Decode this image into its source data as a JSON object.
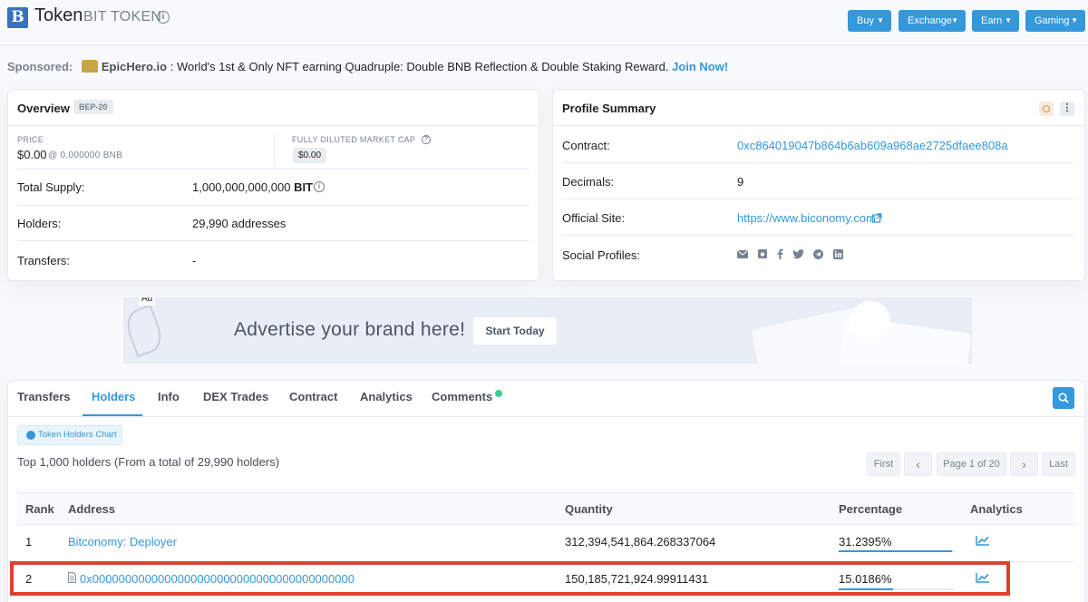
{
  "header": {
    "logo_letter": "B",
    "title": "Token",
    "subtitle": "BIT TOKEN",
    "info_icon": "info-circle-icon",
    "menu": [
      {
        "label": "Buy"
      },
      {
        "label": "Exchange"
      },
      {
        "label": "Earn"
      },
      {
        "label": "Gaming"
      }
    ]
  },
  "sponsored": {
    "label": "Sponsored:",
    "brand": "EpicHero.io",
    "text": ": World's 1st & Only NFT earning Quadruple: Double BNB Reflection & Double Staking Reward.",
    "cta": "Join Now!"
  },
  "overview": {
    "title": "Overview",
    "badge": "BEP-20",
    "price_label": "PRICE",
    "price": "$0.00",
    "price_bnb": "@ 0.000000 BNB",
    "fdmc_label": "FULLY DILUTED MARKET CAP",
    "fdmc_value": "$0.00",
    "total_supply_label": "Total Supply:",
    "total_supply_value": "1,000,000,000,000",
    "total_supply_symbol": "BIT",
    "holders_label": "Holders:",
    "holders_value": "29,990 addresses",
    "transfers_label": "Transfers:",
    "transfers_value": "-"
  },
  "profile": {
    "title": "Profile Summary",
    "contract_label": "Contract:",
    "contract_value": "0xc864019047b864b6ab609a968ae2725dfaee808a",
    "decimals_label": "Decimals:",
    "decimals_value": "9",
    "site_label": "Official Site:",
    "site_value": "https://www.biconomy.com",
    "social_label": "Social Profiles:",
    "social_icons": [
      "email-icon",
      "medium-icon",
      "facebook-icon",
      "twitter-icon",
      "telegram-icon",
      "linkedin-icon"
    ]
  },
  "ad": {
    "tag": "Ad",
    "text": "Advertise your brand here!",
    "button": "Start Today"
  },
  "tabs": [
    {
      "label": "Transfers",
      "active": false
    },
    {
      "label": "Holders",
      "active": true
    },
    {
      "label": "Info",
      "active": false
    },
    {
      "label": "DEX Trades",
      "active": false
    },
    {
      "label": "Contract",
      "active": false
    },
    {
      "label": "Analytics",
      "active": false
    },
    {
      "label": "Comments",
      "active": false
    }
  ],
  "holders": {
    "chart_button": "Token Holders Chart",
    "summary": "Top 1,000 holders (From a total of 29,990 holders)",
    "pagination": {
      "first": "First",
      "prev": "‹",
      "page": "Page 1 of 20",
      "next": "›",
      "last": "Last"
    },
    "columns": [
      "Rank",
      "Address",
      "Quantity",
      "Percentage",
      "Analytics"
    ],
    "rows": [
      {
        "rank": "1",
        "address": "Bitconomy: Deployer",
        "quantity": "312,394,541,864.268337064",
        "percentage": "31.2395%",
        "pct_value": 0.312395
      },
      {
        "rank": "2",
        "address": "0x0000000000000000000000000000000000000000",
        "quantity": "150,185,721,924.99911431",
        "percentage": "15.0186%",
        "pct_value": 0.150186
      }
    ]
  },
  "colors": {
    "accent": "#3498db",
    "highlight": "#e0412f",
    "online": "#3ecf8e"
  }
}
